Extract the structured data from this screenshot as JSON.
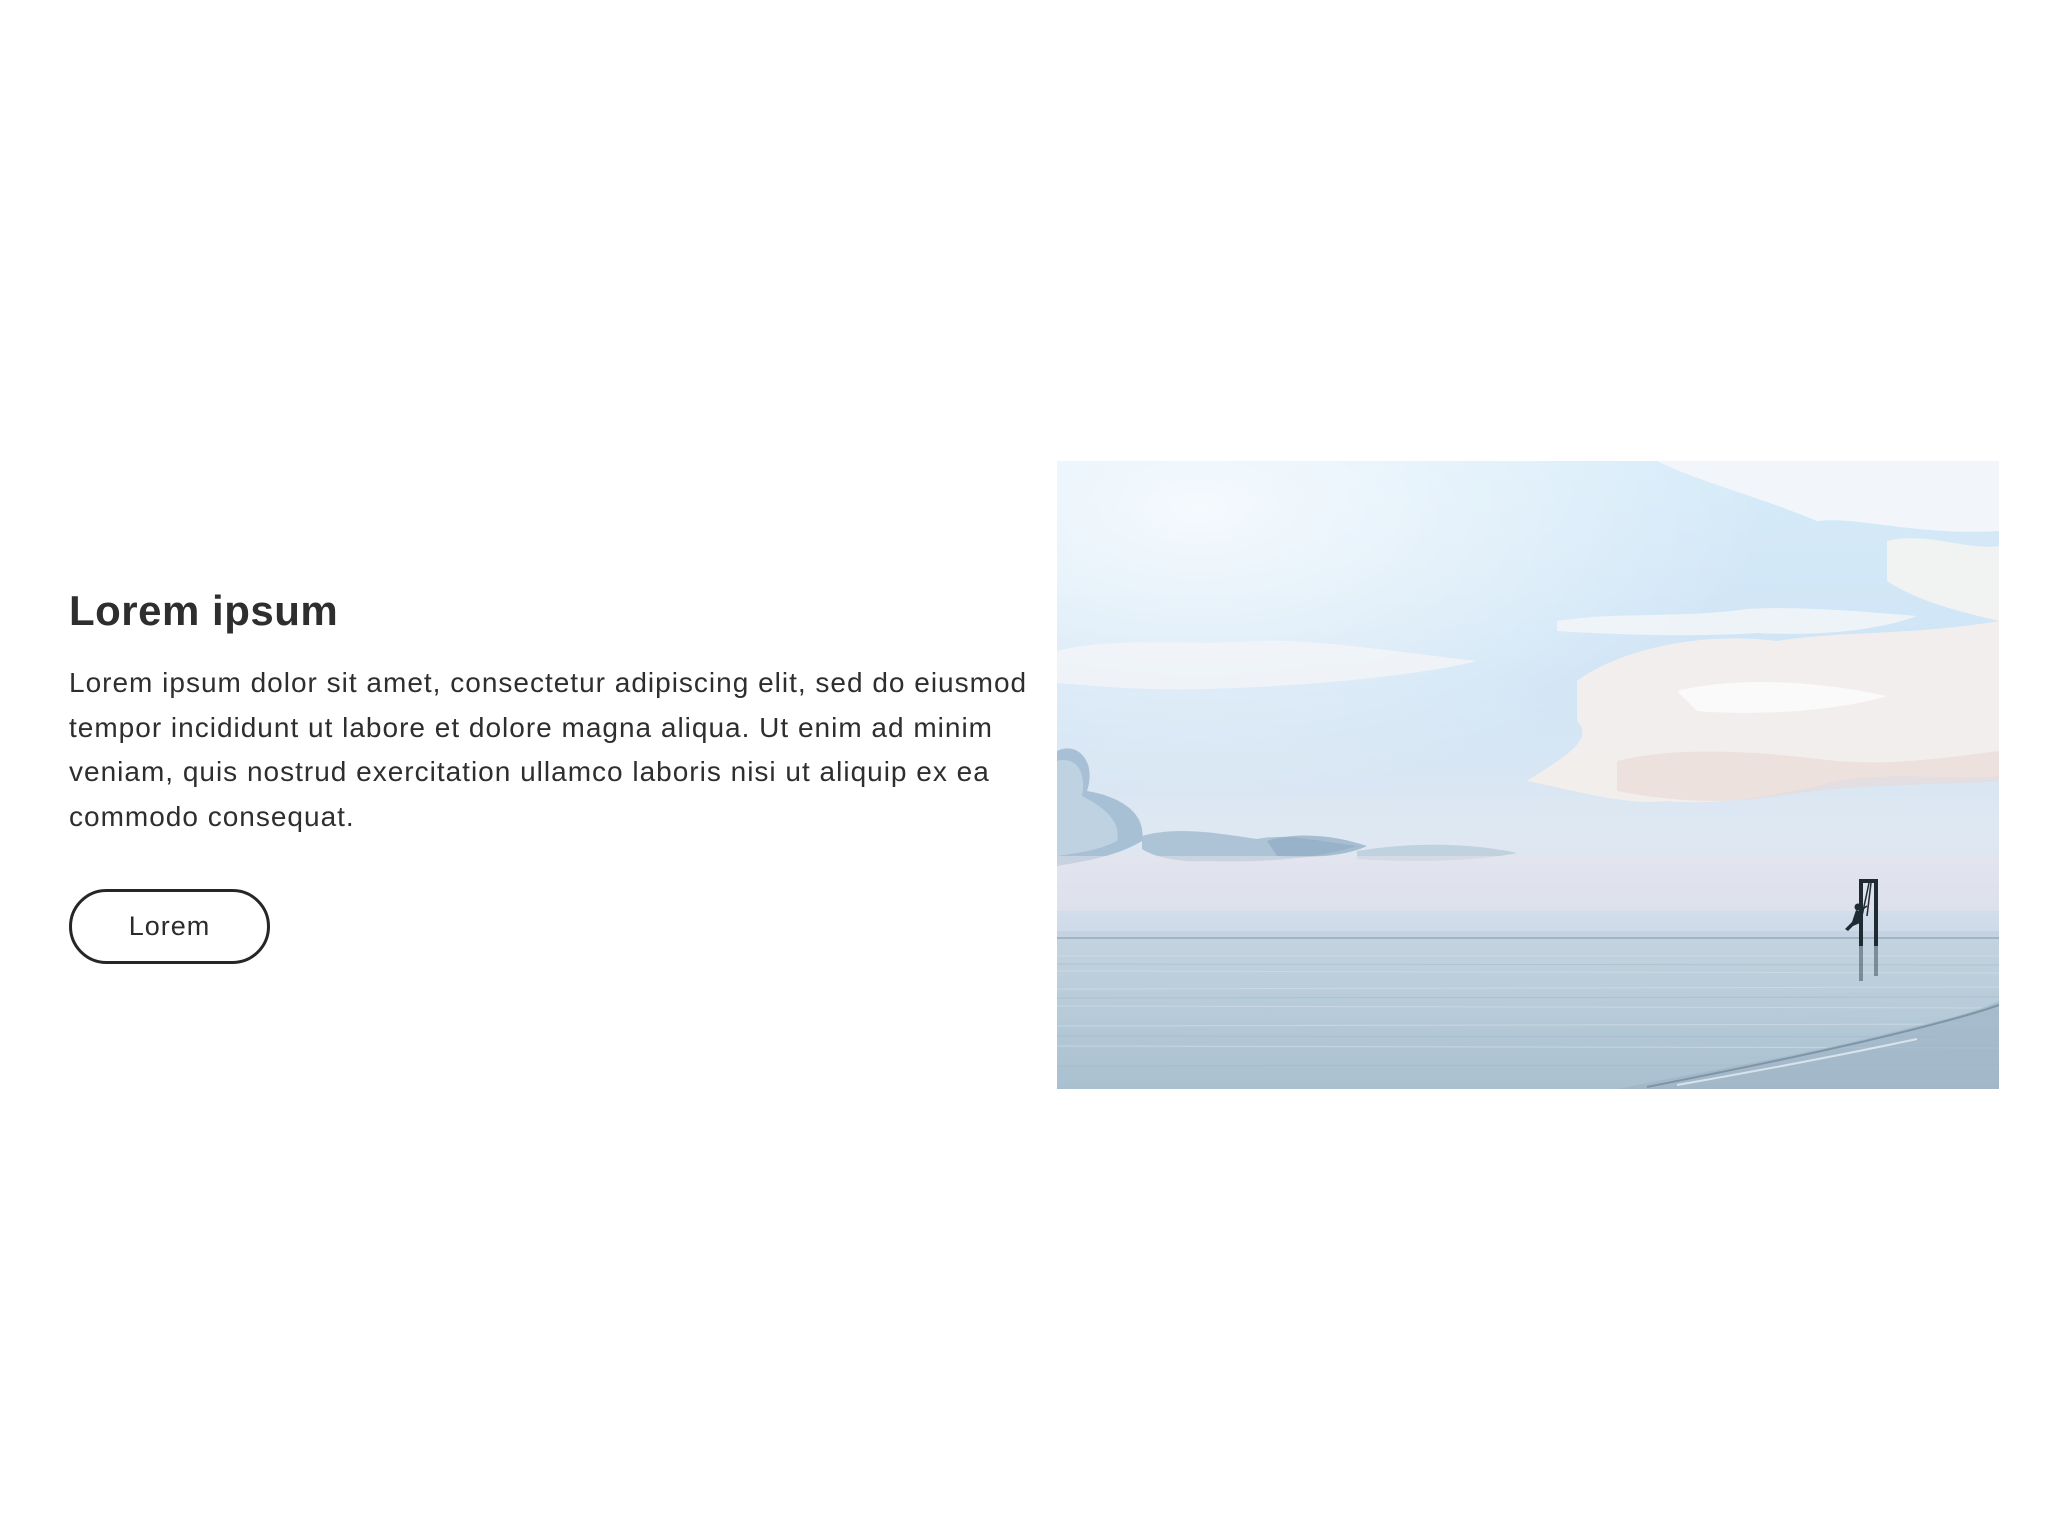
{
  "content": {
    "heading": "Lorem ipsum",
    "body": "Lorem ipsum dolor sit amet, consectetur adipiscing elit, sed do eiusmod tempor incididunt ut labore et dolore magna aliqua. Ut enim ad minim veniam, quis nostrud exercitation ullamco laboris nisi ut aliquip ex ea commodo consequat.",
    "button_label": "Lorem"
  },
  "image": {
    "subject": "seascape-with-swing",
    "colors": {
      "sky_top": "#cfe6f7",
      "sky_light": "#e9f4fc",
      "cloud": "#f6f3f0",
      "cloud_shadow": "#a9c3d8",
      "horizon": "#c9d6e6",
      "water": "#b8ccd9",
      "water_dark": "#8fa7b8",
      "silhouette": "#1f2a33"
    }
  }
}
